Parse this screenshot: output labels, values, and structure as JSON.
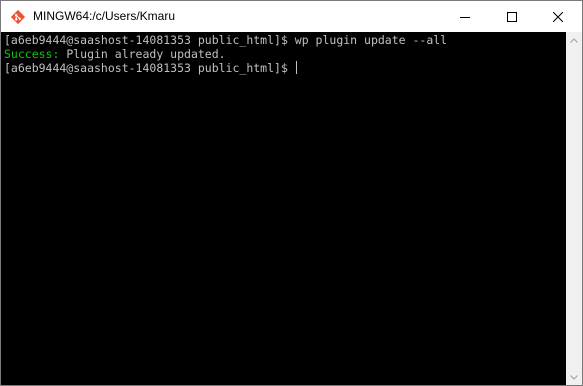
{
  "window": {
    "title": "MINGW64:/c/Users/Kmaru",
    "app_icon": "git-bash-icon",
    "controls": {
      "minimize": "minimize-icon",
      "maximize": "maximize-icon",
      "close": "close-icon"
    }
  },
  "terminal": {
    "line1": "[a6eb9444@saashost-14081353 public_html]$ wp plugin update --all",
    "line2_status": "Success:",
    "line2_message": " Plugin already updated.",
    "line3_prompt": "[a6eb9444@saashost-14081353 public_html]$ "
  },
  "colors": {
    "background": "#000000",
    "text": "#c0c0c0",
    "success": "#13c613",
    "titlebar": "#ffffff"
  }
}
